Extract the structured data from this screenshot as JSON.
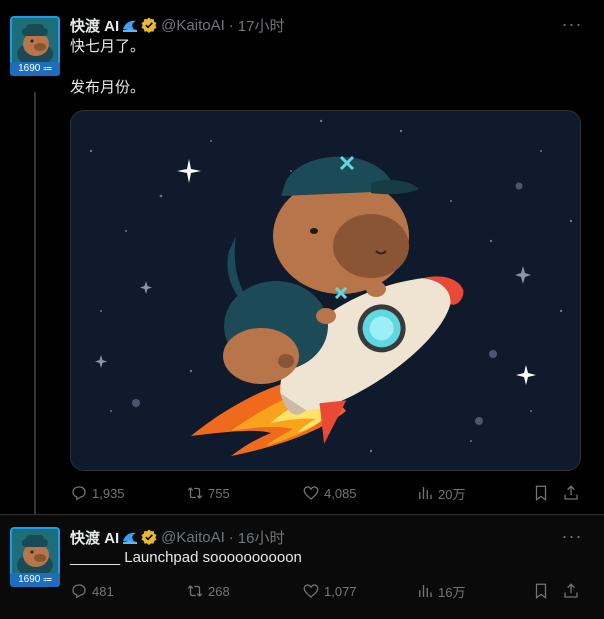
{
  "tweets": [
    {
      "name": "快渡 AI",
      "handle": "@KaitoAI",
      "time": "17小时",
      "badge": "1690 ⩴",
      "lines": [
        "快七月了。",
        "发布月份。"
      ],
      "stats": {
        "replies": "1,935",
        "retweets": "755",
        "likes": "4,085",
        "views": "20万"
      }
    },
    {
      "name": "快渡 AI",
      "handle": "@KaitoAI",
      "time": "16小时",
      "badge": "1690 ⩴",
      "lines": [
        "______ Launchpad soooooooooon"
      ],
      "stats": {
        "replies": "481",
        "retweets": "268",
        "likes": "1,077",
        "views": "16万"
      }
    }
  ],
  "icons": {
    "verified": "verified-badge-icon",
    "wave": "wave-emoji-icon",
    "more": "more-icon",
    "reply": "reply-icon",
    "retweet": "retweet-icon",
    "like": "like-icon",
    "views": "views-icon",
    "bookmark": "bookmark-icon",
    "share": "share-icon"
  },
  "colors": {
    "accent": "#1d9bf0",
    "verified": "#e8b830",
    "muted": "#71767b",
    "text": "#e7e9ea"
  }
}
